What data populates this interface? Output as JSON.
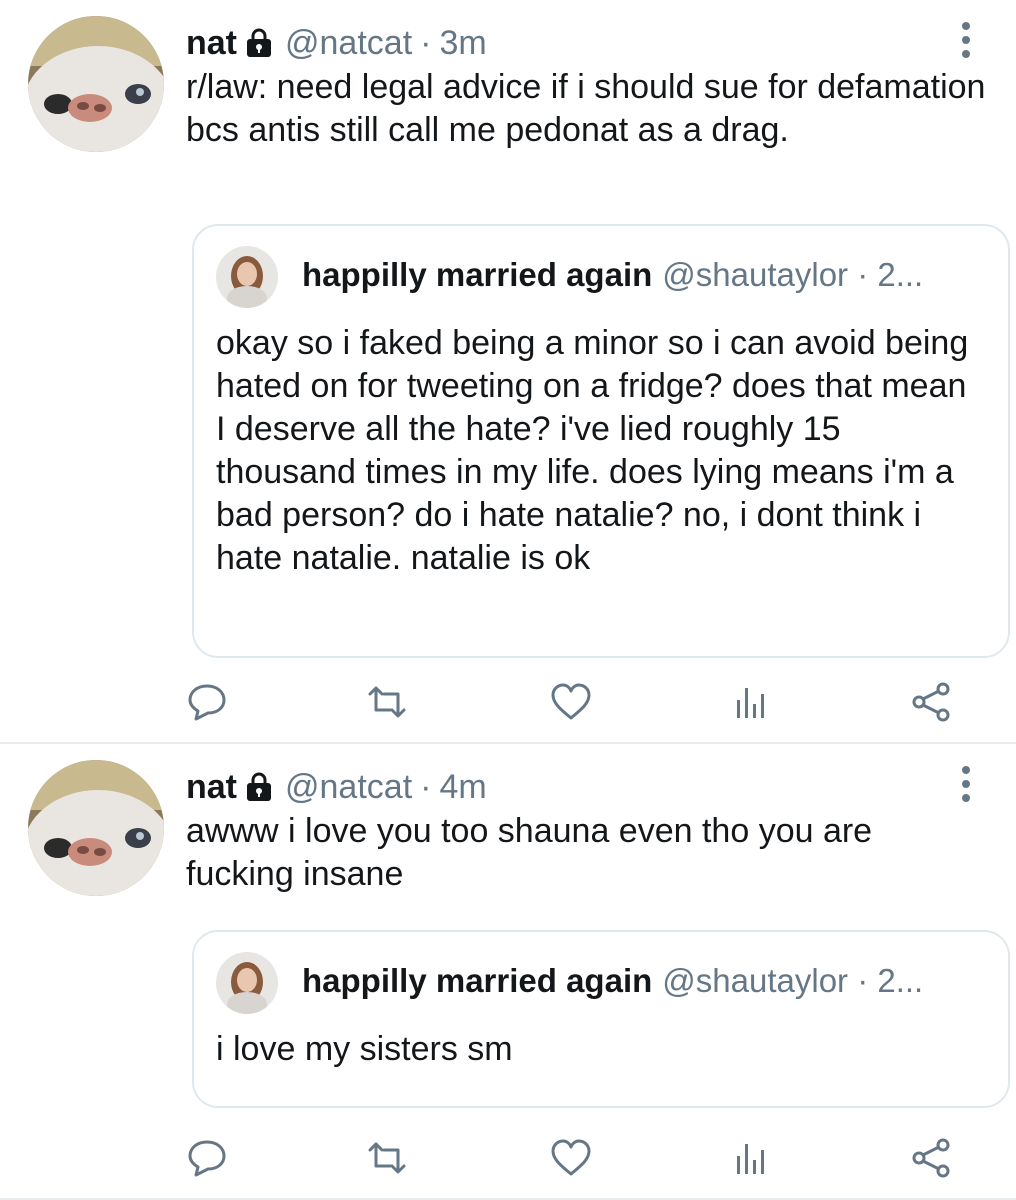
{
  "tweets": [
    {
      "name": "nat",
      "handle": "@natcat",
      "separator": "·",
      "time": "3m",
      "text": "r/law: need legal advice if i should sue for defamation bcs antis still call me pedonat as a drag.",
      "quote": {
        "name": "happilly married again",
        "handle": "@shautaylor · 2...",
        "text": "okay so i faked being a minor so i can avoid being hated on for tweeting on a fridge? does that mean I deserve all the hate? i've lied roughly 15 thousand times in my life. does lying means i'm a bad person? do i hate natalie? no, i dont think i hate natalie. natalie is ok"
      }
    },
    {
      "name": "nat",
      "handle": "@natcat",
      "separator": "·",
      "time": "4m",
      "text": "awww i love you too shauna even tho you are fucking insane",
      "quote": {
        "name": "happilly married again",
        "handle": "@shautaylor · 2...",
        "text": "i love my sisters sm"
      }
    }
  ],
  "icons": {
    "reply": "reply-icon",
    "retweet": "retweet-icon",
    "like": "heart-icon",
    "analytics": "analytics-icon",
    "share": "share-icon",
    "more": "more-vertical-icon",
    "lock": "lock-icon"
  },
  "colors": {
    "text": "#14171a",
    "muted": "#657786",
    "icon": "#657786",
    "border": "#e1e8ed"
  }
}
